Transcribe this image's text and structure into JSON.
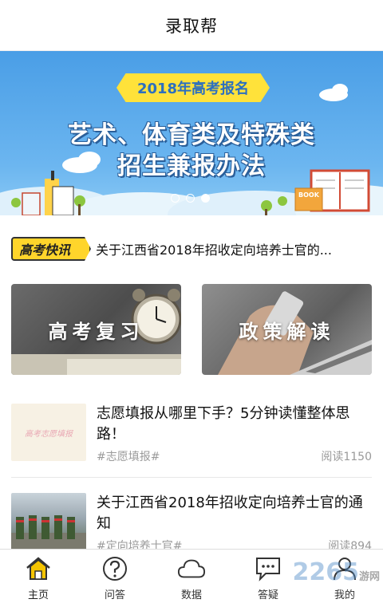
{
  "header": {
    "title": "录取帮"
  },
  "banner": {
    "badge": "2018年高考报名",
    "line1": "艺术、体育类及特殊类",
    "line2": "招生兼报办法",
    "book_label": "BOOK",
    "dots": 3,
    "active_dot": 3
  },
  "news": {
    "tag": "高考快讯",
    "text": "关于江西省2018年招收定向培养士官的..."
  },
  "cards": [
    {
      "label": "高考复习",
      "icon": "alarm-clock-icon"
    },
    {
      "label": "政策解读",
      "icon": "phone-laptop-icon"
    }
  ],
  "articles": [
    {
      "title": "志愿填报从哪里下手？5分钟读懂整体思路！",
      "tag": "#志愿填报#",
      "reads": "阅读1150",
      "thumb_text": "高考志愿填报"
    },
    {
      "title": "关于江西省2018年招收定向培养士官的通知",
      "tag": "#定向培养士官#",
      "reads": "阅读894"
    }
  ],
  "tabs": [
    {
      "label": "主页",
      "icon": "home-icon"
    },
    {
      "label": "问答",
      "icon": "question-icon"
    },
    {
      "label": "数据",
      "icon": "cloud-icon"
    },
    {
      "label": "答疑",
      "icon": "chat-icon"
    },
    {
      "label": "我的",
      "icon": "user-icon"
    }
  ],
  "watermark": {
    "brand": "2265",
    "suffix": "游网"
  },
  "colors": {
    "accent_yellow": "#ffd52b",
    "banner_blue": "#4a9ee6",
    "home_icon": "#f5c400"
  }
}
